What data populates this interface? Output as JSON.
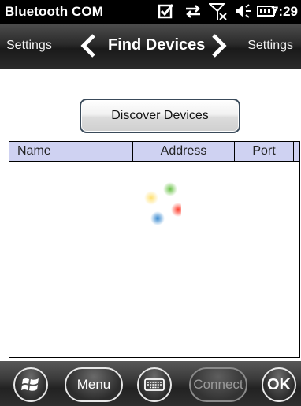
{
  "status_bar": {
    "app_title": "Bluetooth COM",
    "time": "7:29",
    "icons": [
      "checkbox-checked-icon",
      "sync-arrows-icon",
      "signal-off-icon",
      "volume-icon",
      "battery-icon"
    ]
  },
  "nav": {
    "left_label": "Settings",
    "title": "Find Devices",
    "right_label": "Settings"
  },
  "discover_button": {
    "label": "Discover Devices"
  },
  "table": {
    "columns": [
      "Name",
      "Address",
      "Port",
      ""
    ],
    "rows": [],
    "loading": true
  },
  "app_bar": {
    "start_icon": "windows-start-icon",
    "menu_label": "Menu",
    "keyboard_icon": "keyboard-icon",
    "connect_label": "Connect",
    "connect_enabled": false,
    "ok_label": "OK"
  }
}
